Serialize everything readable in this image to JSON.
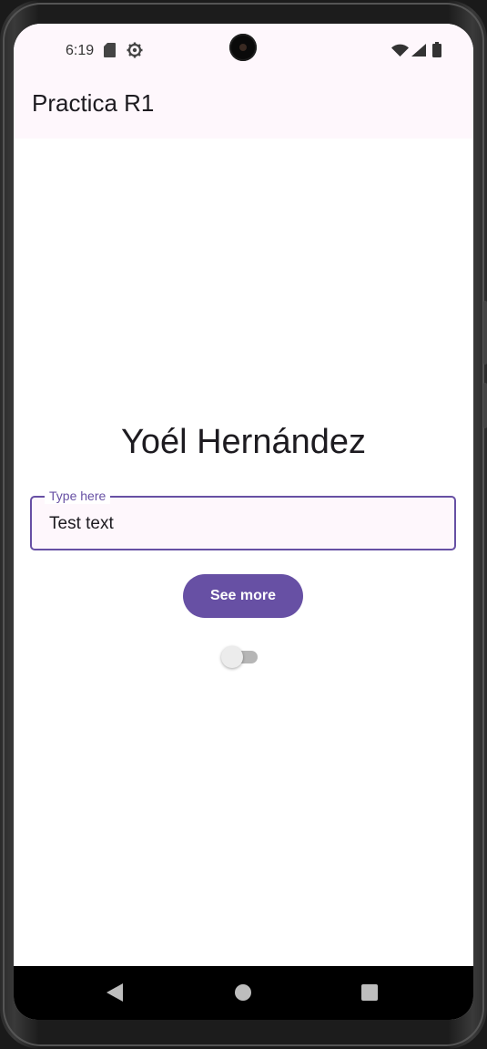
{
  "status_bar": {
    "time": "6:19",
    "icons": [
      "sd-card-icon",
      "settings-gear-icon",
      "wifi-icon",
      "cell-signal-icon",
      "battery-icon"
    ]
  },
  "app_bar": {
    "title": "Practica R1"
  },
  "main": {
    "heading": "Yoél Hernández",
    "text_field": {
      "label": "Type here",
      "value": "Test text"
    },
    "button": {
      "label": "See more"
    },
    "switch": {
      "checked": false
    }
  },
  "nav_bar": {
    "icons": [
      "back-icon",
      "home-icon",
      "recents-icon"
    ]
  },
  "colors": {
    "primary": "#6750a4",
    "surface_tint": "#fef7fc",
    "on_surface": "#1d1b20",
    "navbar": "#000000"
  }
}
